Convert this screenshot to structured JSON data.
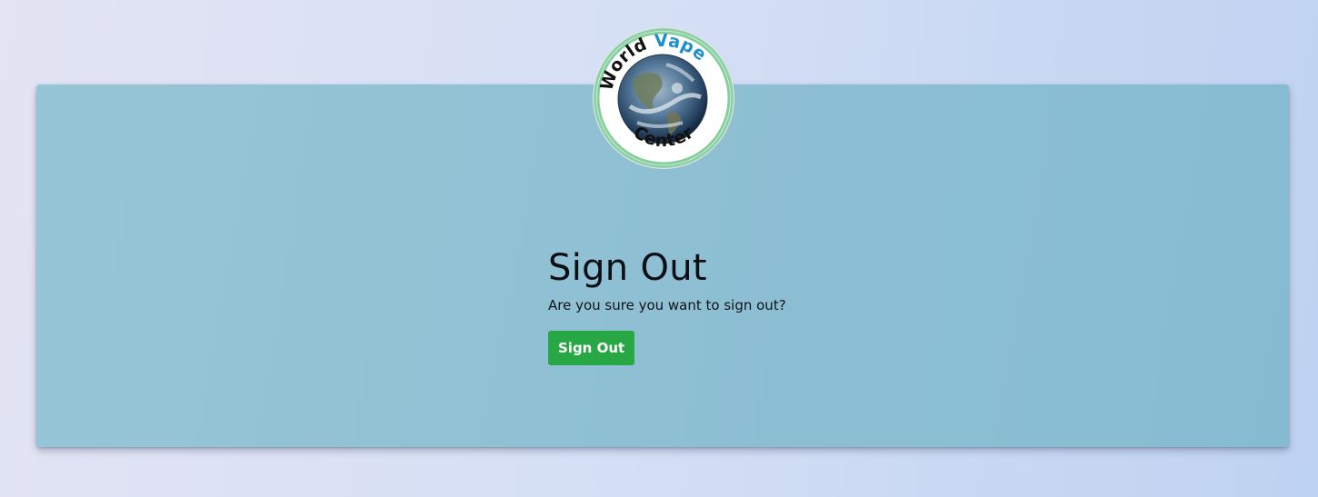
{
  "logo": {
    "word_top_left": "World",
    "word_top_right": "Vape",
    "word_bottom": "Center",
    "color_dark": "#111111",
    "color_accent": "#1b8fd0"
  },
  "signout": {
    "title": "Sign Out",
    "message": "Are you sure you want to sign out?",
    "button_label": "Sign Out"
  },
  "colors": {
    "button": "#28a745",
    "card": "#8fc0d4"
  }
}
